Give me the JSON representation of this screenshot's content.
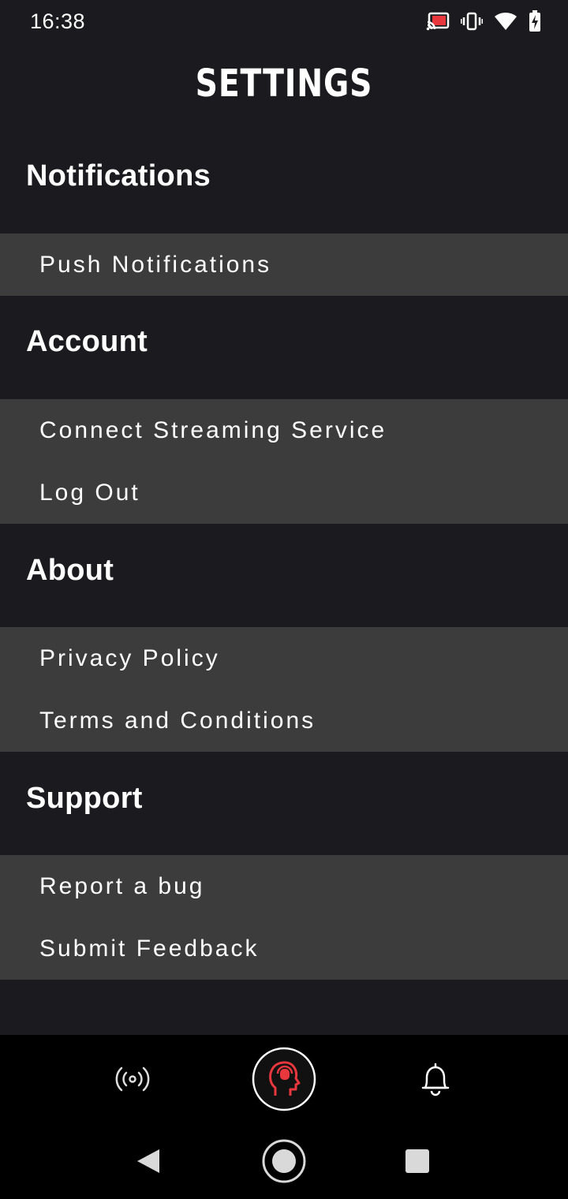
{
  "status_bar": {
    "time": "16:38",
    "icons": [
      "cast-icon",
      "vibrate-icon",
      "wifi-icon",
      "battery-charging-icon"
    ]
  },
  "title": "SETTINGS",
  "sections": {
    "notifications": {
      "heading": "Notifications",
      "items": [
        "Push Notifications"
      ]
    },
    "account": {
      "heading": "Account",
      "items": [
        "Connect Streaming Service",
        "Log Out"
      ]
    },
    "about": {
      "heading": "About",
      "items": [
        "Privacy Policy",
        "Terms and Conditions"
      ]
    },
    "support": {
      "heading": "Support",
      "items": [
        "Report a bug",
        "Submit Feedback"
      ]
    }
  },
  "tab_bar": {
    "icons": [
      "broadcast-icon",
      "head-profile-icon",
      "bell-icon"
    ],
    "accent_color": "#e8383d"
  },
  "colors": {
    "background": "#1b1a1f",
    "row_background": "#3c3c3d",
    "text": "#ffffff"
  }
}
